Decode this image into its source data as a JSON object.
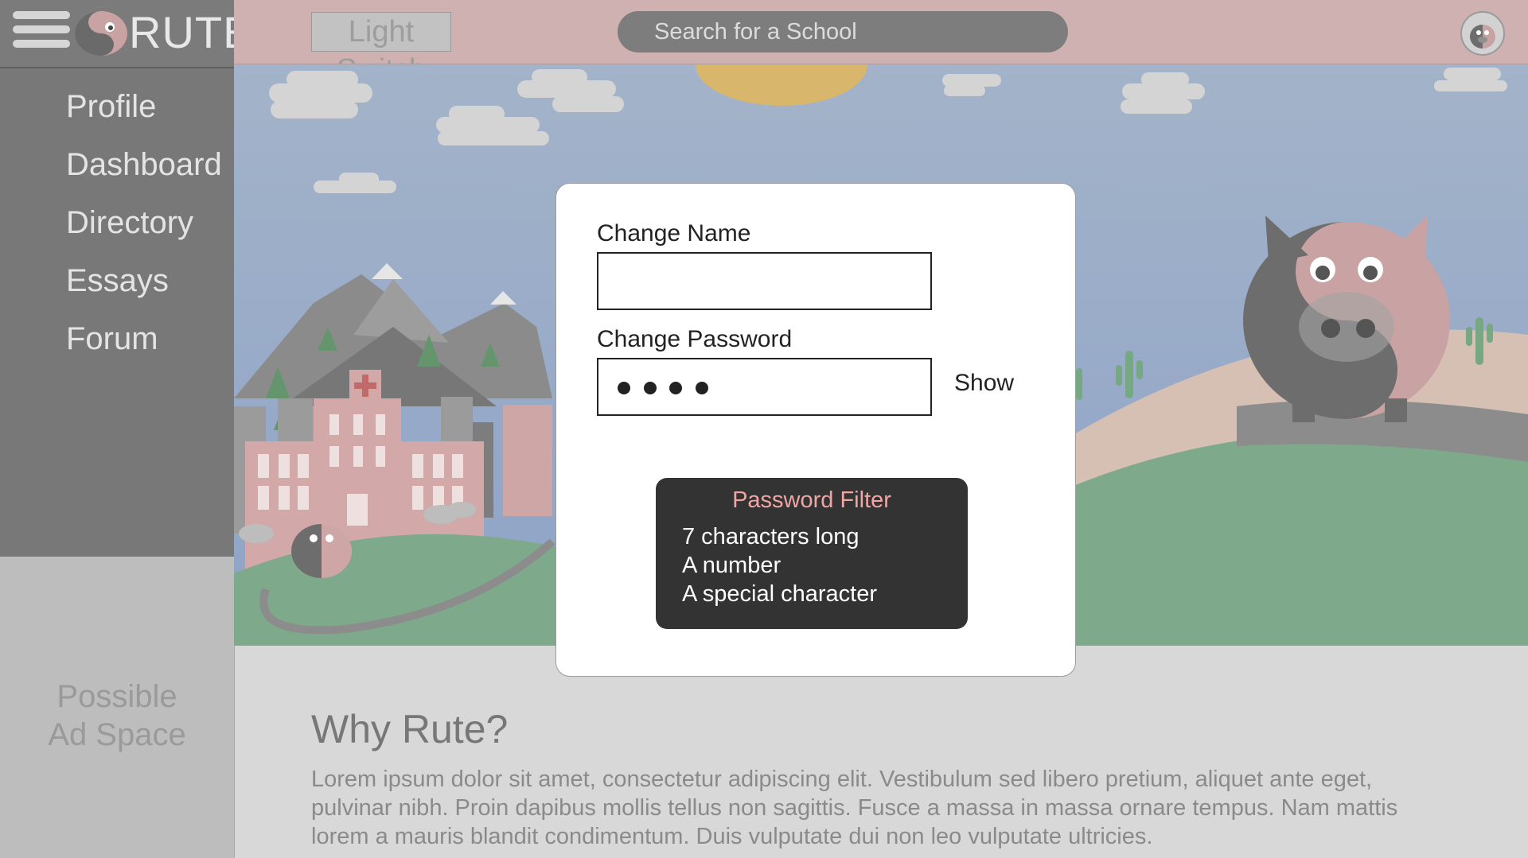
{
  "app": {
    "logo_text": "RUTE"
  },
  "sidebar": {
    "items": [
      {
        "label": "Profile"
      },
      {
        "label": "Dashboard"
      },
      {
        "label": "Directory"
      },
      {
        "label": "Essays"
      },
      {
        "label": "Forum"
      }
    ],
    "ad_space": {
      "line1": "Possible",
      "line2": "Ad Space"
    }
  },
  "topbar": {
    "light_switch_label": "Light Switch",
    "search_placeholder": "Search for a School"
  },
  "modal": {
    "name_label": "Change Name",
    "name_value": "",
    "password_label": "Change Password",
    "password_masked_length": 4,
    "show_label": "Show",
    "filter": {
      "title": "Password Filter",
      "rules": [
        "7 characters long",
        "A number",
        "A special character"
      ]
    }
  },
  "content": {
    "why_title": "Why Rute?",
    "why_body": "Lorem ipsum dolor sit amet, consectetur adipiscing elit. Vestibulum sed libero pretium, aliquet ante eget, pulvinar nibh. Proin dapibus mollis tellus non sagittis. Fusce a massa in massa ornare tempus. Nam mattis lorem a mauris blandit condimentum. Duis vulputate dui non leo vulputate ultricies."
  },
  "colors": {
    "sidebar": "#787878",
    "topbar": "#cfb1b2",
    "filter_title": "#f1a5a5",
    "modal_bg": "#ffffff"
  },
  "icons": {
    "menu": "hamburger-menu-icon",
    "logo": "yin-yang-pig-logo-icon",
    "avatar": "pig-avatar-icon"
  }
}
